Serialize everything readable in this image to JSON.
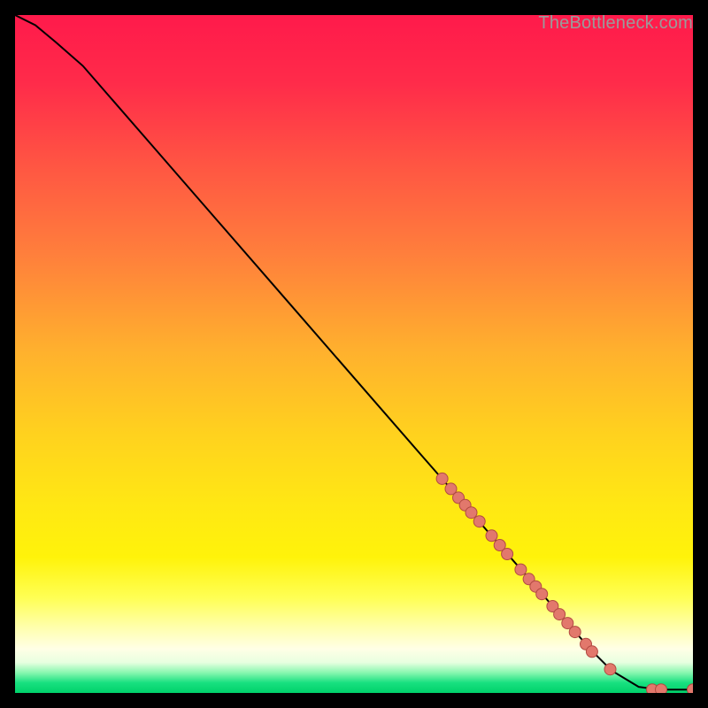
{
  "watermark": "TheBottleneck.com",
  "gradient": {
    "stops": [
      {
        "offset": 0.0,
        "color": "#ff1a4b"
      },
      {
        "offset": 0.1,
        "color": "#ff2b4a"
      },
      {
        "offset": 0.22,
        "color": "#ff5543"
      },
      {
        "offset": 0.35,
        "color": "#ff7e3c"
      },
      {
        "offset": 0.5,
        "color": "#ffb22d"
      },
      {
        "offset": 0.62,
        "color": "#ffd21e"
      },
      {
        "offset": 0.72,
        "color": "#ffe714"
      },
      {
        "offset": 0.8,
        "color": "#fff30a"
      },
      {
        "offset": 0.86,
        "color": "#ffff55"
      },
      {
        "offset": 0.905,
        "color": "#ffffb0"
      },
      {
        "offset": 0.935,
        "color": "#ffffe6"
      },
      {
        "offset": 0.955,
        "color": "#e8ffe0"
      },
      {
        "offset": 0.97,
        "color": "#88f7b0"
      },
      {
        "offset": 0.985,
        "color": "#18e080"
      },
      {
        "offset": 1.0,
        "color": "#00d26a"
      }
    ]
  },
  "chart_data": {
    "type": "line",
    "title": "",
    "xlabel": "",
    "ylabel": "",
    "xlim": [
      0,
      100
    ],
    "ylim": [
      0,
      100
    ],
    "series": [
      {
        "name": "curve",
        "x": [
          0,
          3,
          6,
          10,
          20,
          30,
          40,
          50,
          60,
          65,
          70,
          75,
          80,
          85,
          88,
          92,
          95,
          97,
          100
        ],
        "y": [
          100,
          98.5,
          96,
          92.5,
          81,
          69.5,
          58,
          46.5,
          35,
          29.3,
          23.5,
          17.8,
          12,
          6.3,
          3.3,
          0.9,
          0.5,
          0.5,
          0.5
        ]
      }
    ],
    "markers": [
      {
        "x": 63.0,
        "y": 31.6,
        "r": 6.5
      },
      {
        "x": 64.3,
        "y": 30.1,
        "r": 6.5
      },
      {
        "x": 65.4,
        "y": 28.8,
        "r": 6.5
      },
      {
        "x": 66.4,
        "y": 27.7,
        "r": 6.5
      },
      {
        "x": 67.3,
        "y": 26.6,
        "r": 6.5
      },
      {
        "x": 68.5,
        "y": 25.3,
        "r": 6.5
      },
      {
        "x": 70.3,
        "y": 23.2,
        "r": 6.5
      },
      {
        "x": 71.5,
        "y": 21.8,
        "r": 6.5
      },
      {
        "x": 72.6,
        "y": 20.5,
        "r": 6.5
      },
      {
        "x": 74.6,
        "y": 18.2,
        "r": 6.5
      },
      {
        "x": 75.8,
        "y": 16.8,
        "r": 6.5
      },
      {
        "x": 76.8,
        "y": 15.7,
        "r": 6.5
      },
      {
        "x": 77.7,
        "y": 14.6,
        "r": 6.5
      },
      {
        "x": 79.3,
        "y": 12.8,
        "r": 6.5
      },
      {
        "x": 80.3,
        "y": 11.6,
        "r": 6.5
      },
      {
        "x": 81.5,
        "y": 10.3,
        "r": 6.5
      },
      {
        "x": 82.6,
        "y": 9.0,
        "r": 6.5
      },
      {
        "x": 84.2,
        "y": 7.2,
        "r": 6.5
      },
      {
        "x": 85.1,
        "y": 6.1,
        "r": 6.5
      },
      {
        "x": 87.8,
        "y": 3.5,
        "r": 6.5
      },
      {
        "x": 94.0,
        "y": 0.5,
        "r": 6.5
      },
      {
        "x": 95.3,
        "y": 0.5,
        "r": 6.5
      },
      {
        "x": 100.0,
        "y": 0.5,
        "r": 6.5
      }
    ],
    "marker_style": {
      "fill": "#e2786c",
      "stroke": "#b24a42"
    },
    "line_style": {
      "stroke": "#000000",
      "width": 2
    }
  }
}
